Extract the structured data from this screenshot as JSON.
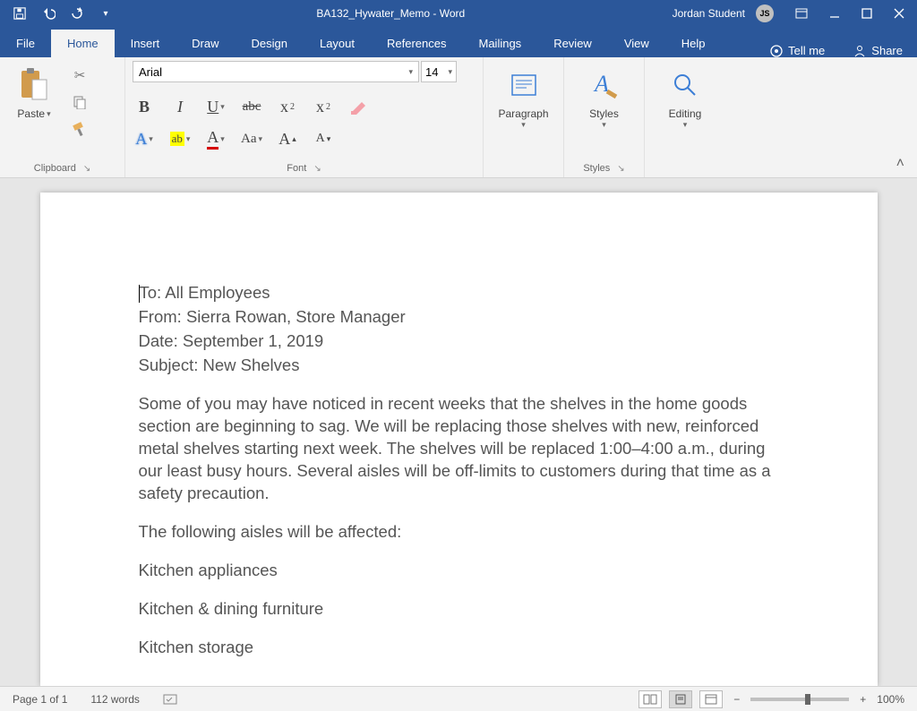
{
  "title": "BA132_Hywater_Memo  -  Word",
  "user": {
    "name": "Jordan Student",
    "initials": "JS"
  },
  "tabs": [
    "File",
    "Home",
    "Insert",
    "Draw",
    "Design",
    "Layout",
    "References",
    "Mailings",
    "Review",
    "View",
    "Help"
  ],
  "tellme": "Tell me",
  "share": "Share",
  "font": {
    "name": "Arial",
    "size": "14"
  },
  "groups": {
    "clipboard": "Clipboard",
    "font": "Font",
    "styles": "Styles",
    "paste": "Paste",
    "paragraph": "Paragraph",
    "styles_btn": "Styles",
    "editing": "Editing"
  },
  "fmt": {
    "B": "B",
    "I": "I",
    "U": "U",
    "abc": "abc",
    "x2": "x",
    "X2": "x",
    "A1": "A",
    "A2": "A",
    "Aa": "Aa",
    "Ap": "A",
    "Am": "A",
    "ab": "ab"
  },
  "doc": {
    "to": "To: All Employees",
    "from": "From: Sierra Rowan, Store Manager",
    "date": "Date: September 1, 2019",
    "subject": "Subject: New Shelves",
    "body": "Some of you may have noticed in recent weeks that the shelves in the home goods section are beginning to sag. We will be replacing those shelves with new, reinforced metal shelves starting next week. The shelves will be replaced 1:00–4:00 a.m., during our least busy hours. Several aisles will be off-limits to customers during that time as a safety precaution.",
    "following": "The following aisles will be affected:",
    "a1": "Kitchen appliances",
    "a2": "Kitchen & dining furniture",
    "a3": "Kitchen storage"
  },
  "status": {
    "page": "Page 1 of 1",
    "words": "112 words",
    "zoom": "100%"
  }
}
